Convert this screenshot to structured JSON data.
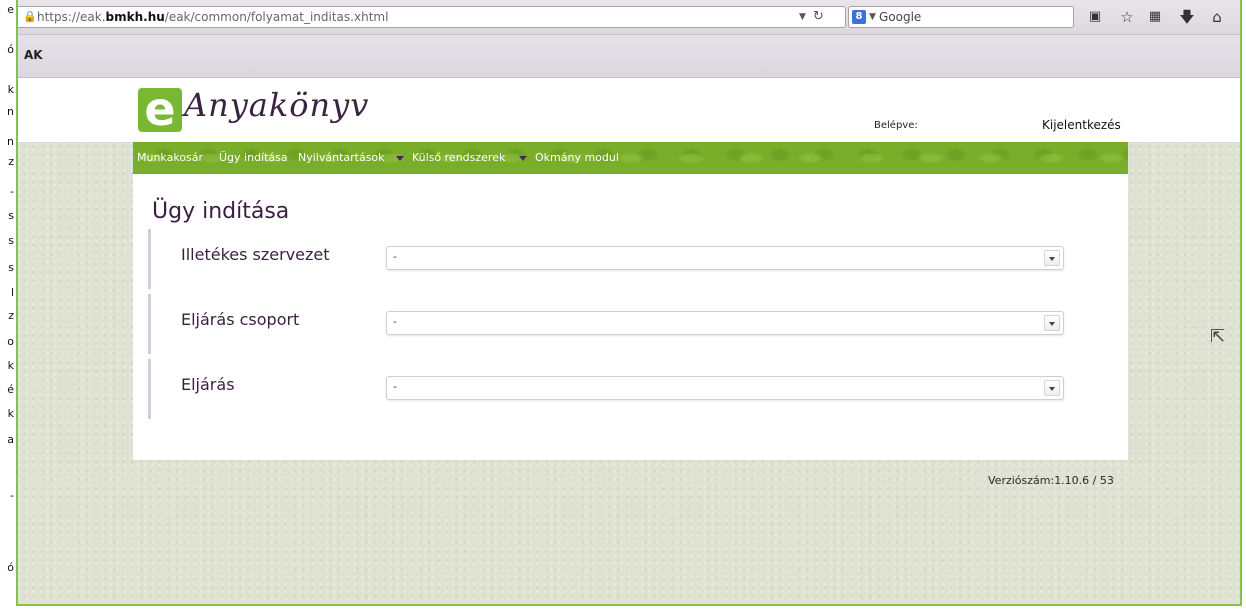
{
  "left_strip": [
    "e",
    "ó",
    "k",
    "n",
    "n",
    "z",
    "-",
    "s",
    "s",
    "s",
    "l",
    "z",
    "o",
    "k",
    "é",
    "k",
    "a",
    "-",
    "ó"
  ],
  "browser": {
    "url_prefix": "https://eak.",
    "url_domain": "bmkh.hu",
    "url_path": "/eak/common/folyamat_inditas.xhtml",
    "search_engine_icon": "google-icon",
    "search_placeholder": "Google",
    "bookmark_label": "AK"
  },
  "header": {
    "logo_letter": "e",
    "logo_text": "Anyakönyv",
    "logged_in_label": "Belépve:",
    "logout_label": "Kijelentkezés"
  },
  "menu": {
    "items": [
      {
        "label": "Munkakosár"
      },
      {
        "label": "Ügy indítása"
      },
      {
        "label": "Nyilvántartások"
      },
      {
        "label": "Külső rendszerek"
      },
      {
        "label": "Okmány modul"
      }
    ]
  },
  "panel": {
    "title": "Ügy indítása",
    "fields": [
      {
        "label": "Illetékes szervezet",
        "value": "-"
      },
      {
        "label": "Eljárás csoport",
        "value": "-"
      },
      {
        "label": "Eljárás",
        "value": "-"
      }
    ]
  },
  "footer": {
    "version": "Verziószám:1.10.6 / 53"
  },
  "colors": {
    "brand_green": "#79ad2a",
    "frame_green": "#86c24a",
    "title_purple": "#3a1f40"
  }
}
